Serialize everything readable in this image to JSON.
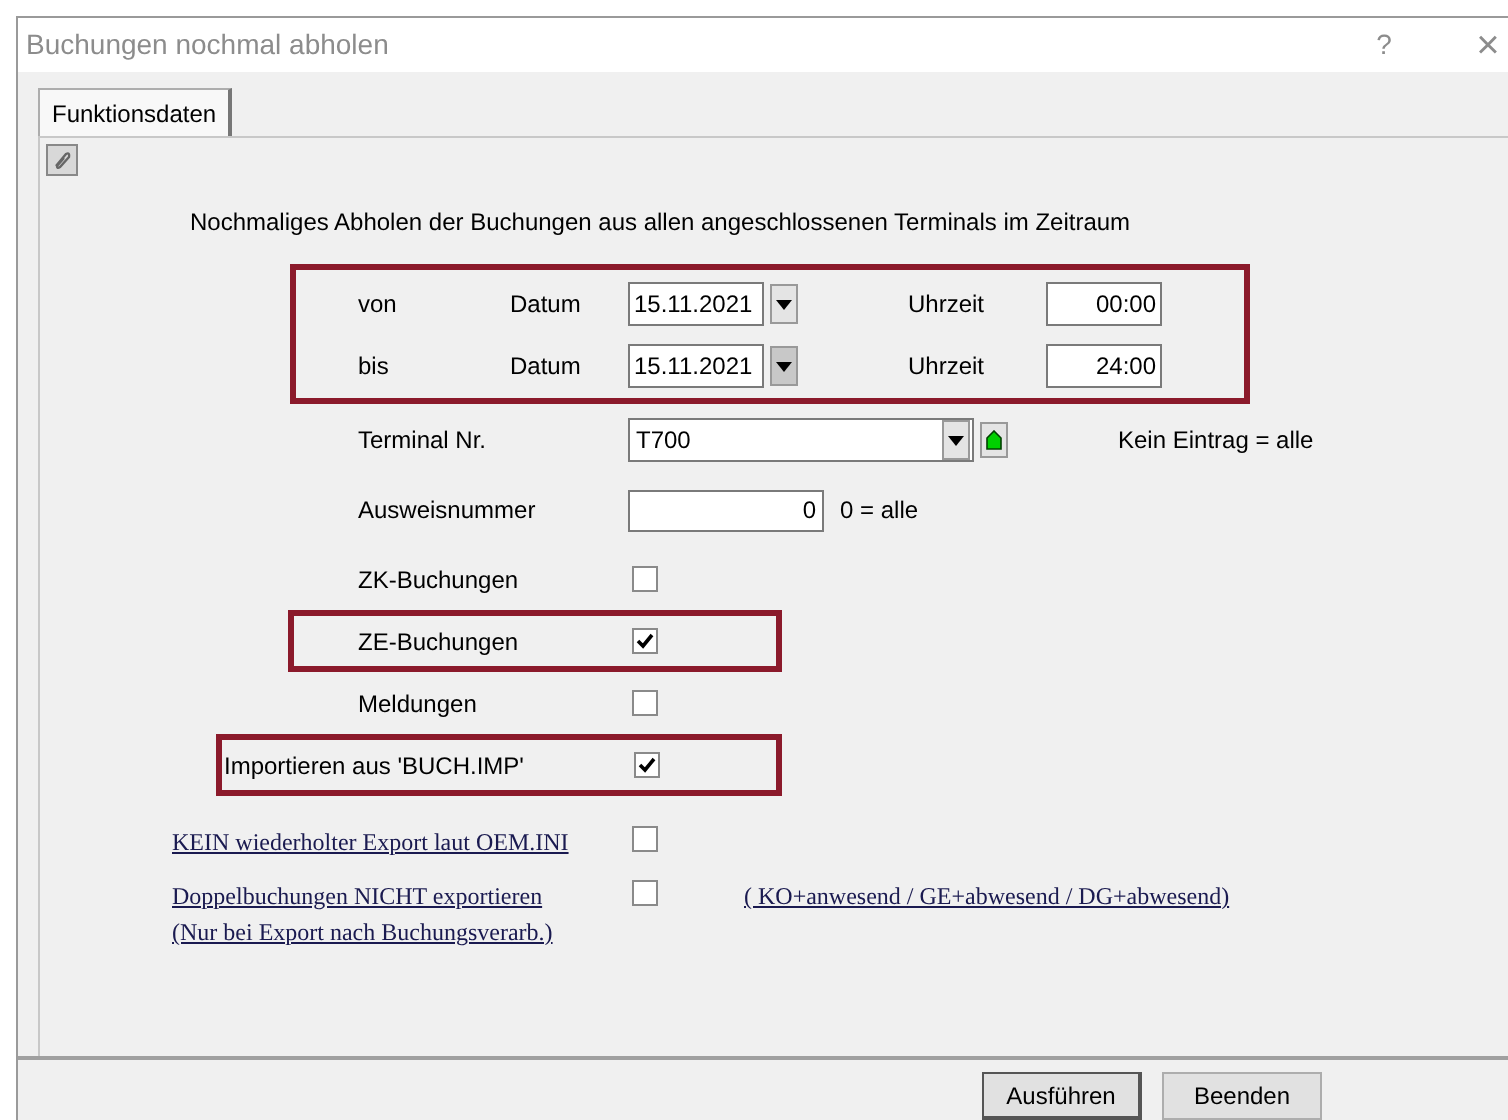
{
  "window": {
    "title": "Buchungen nochmal abholen",
    "help": "?",
    "close": "×"
  },
  "tabs": [
    {
      "label": "Funktionsdaten",
      "selected": true
    }
  ],
  "intro": "Nochmaliges Abholen der Buchungen aus allen angeschlossenen Terminals im Zeitraum",
  "date_range": {
    "highlighted": true,
    "rows": [
      {
        "label": "von",
        "date_label": "Datum",
        "date": "15.11.2021",
        "time_label": "Uhrzeit",
        "time": "00:00"
      },
      {
        "label": "bis",
        "date_label": "Datum",
        "date": "15.11.2021",
        "time_label": "Uhrzeit",
        "time": "24:00"
      }
    ]
  },
  "terminal": {
    "label": "Terminal Nr.",
    "value": "T700",
    "hint": "Kein Eintrag = alle"
  },
  "badge": {
    "label": "Ausweisnummer",
    "value": "0",
    "hint": "0 = alle"
  },
  "options": [
    {
      "kind": "option",
      "label": "ZK-Buchungen",
      "checked": false,
      "highlighted": false
    },
    {
      "kind": "option",
      "label": "ZE-Buchungen",
      "checked": true,
      "highlighted": true
    },
    {
      "kind": "option",
      "label": "Meldungen",
      "checked": false,
      "highlighted": false
    },
    {
      "kind": "import",
      "label": "Importieren aus 'BUCH.IMP'",
      "checked": true,
      "highlighted": true
    }
  ],
  "exports": [
    {
      "label": "KEIN wiederholter Export laut OEM.INI",
      "checked": false
    },
    {
      "label": "Doppelbuchungen NICHT exportieren",
      "sublabel": "(Nur bei Export nach Buchungsverarb.)",
      "checked": false,
      "note": "( KO+anwesend / GE+abwesend / DG+abwesend)"
    }
  ],
  "buttons": [
    "Ausführen",
    "Beenden"
  ]
}
